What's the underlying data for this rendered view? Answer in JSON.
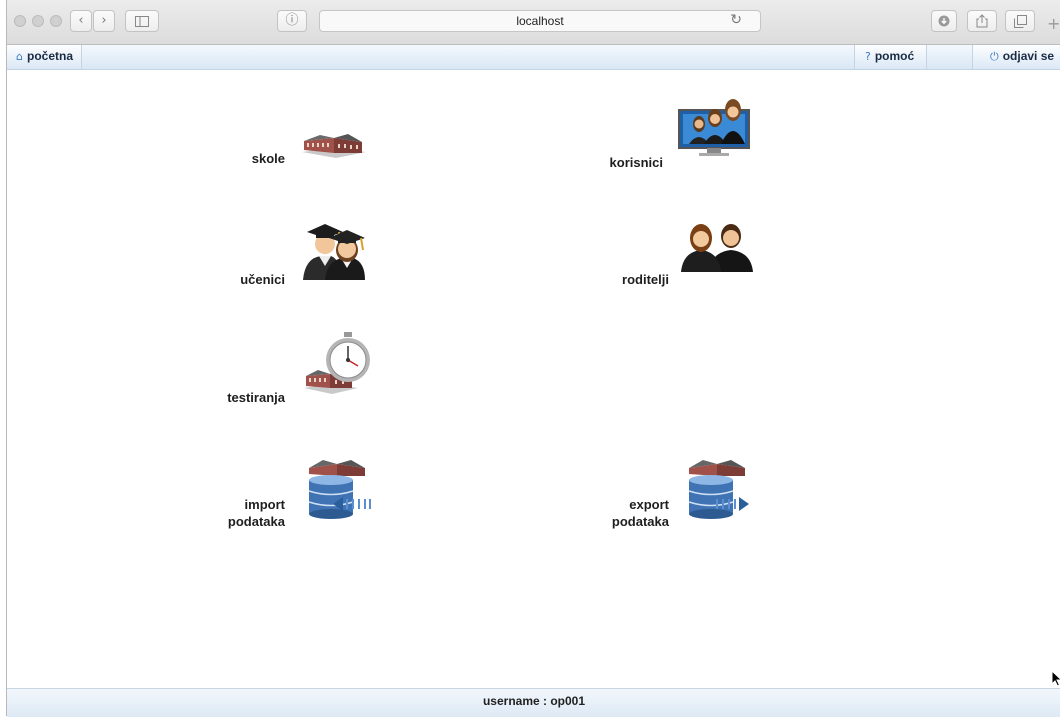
{
  "browser": {
    "url": "localhost",
    "back_glyph": "‹",
    "forward_glyph": "›",
    "info_glyph": "ⓘ",
    "reload_glyph": "↻",
    "new_tab_glyph": "+"
  },
  "nav": {
    "home": {
      "label": "početna",
      "icon": "house-icon",
      "icon_glyph": "⌂"
    },
    "help": {
      "label": "pomoć",
      "icon": "question-icon",
      "icon_glyph": "?"
    },
    "logout": {
      "label": "odjavi se",
      "icon": "power-icon",
      "icon_glyph": "⏻"
    }
  },
  "menu": {
    "skole": {
      "label": "skole",
      "icon": "school-building-icon"
    },
    "korisnici": {
      "label": "korisnici",
      "icon": "users-monitor-icon"
    },
    "ucenici": {
      "label": "učenici",
      "icon": "graduate-students-icon"
    },
    "roditelji": {
      "label": "roditelji",
      "icon": "parents-icon"
    },
    "testiranja": {
      "label": "testiranja",
      "icon": "stopwatch-school-icon"
    },
    "import": {
      "label_line1": "import",
      "label_line2": "podataka",
      "icon": "database-import-icon"
    },
    "export": {
      "label_line1": "export",
      "label_line2": "podataka",
      "icon": "database-export-icon"
    }
  },
  "status": {
    "text": "username : op001"
  },
  "colors": {
    "nav_text": "#1a2c44",
    "nav_icon": "#3b78c2",
    "building": "#a0524a",
    "database": "#3f73b3"
  }
}
